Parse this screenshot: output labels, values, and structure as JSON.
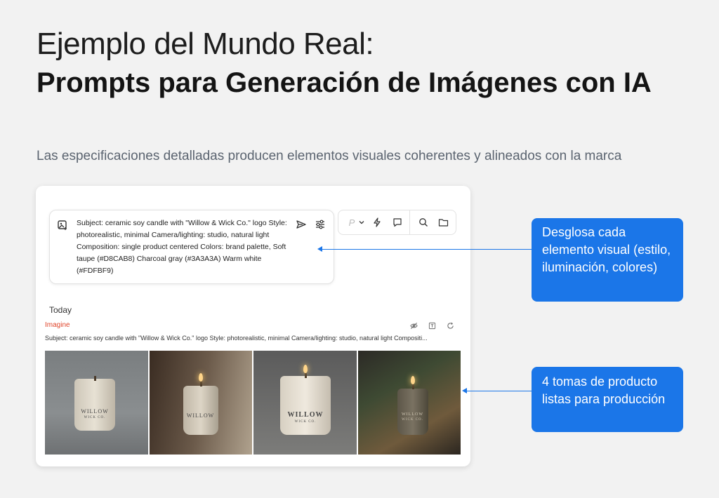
{
  "slide": {
    "title_line1": "Ejemplo del Mundo Real:",
    "title_line2": "Prompts para Generación de Imágenes con IA",
    "subtitle": "Las especificaciones detalladas producen elementos visuales coherentes y alineados con la marca"
  },
  "prompt_box": {
    "text": "Subject: ceramic soy candle with \"Willow & Wick Co.\" logo Style: photorealistic, minimal Camera/lighting: studio, natural light Composition: single product centered Colors: brand palette, Soft taupe (#D8CAB8) Charcoal gray (#3A3A3A) Warm white (#FDFBF9)"
  },
  "toolbar": {
    "model_letter": "P"
  },
  "history": {
    "section": "Today",
    "tag": "Imagine",
    "prompt_preview": "Subject: ceramic soy candle with \"Willow & Wick Co.\" logo Style: photorealistic, minimal Camera/lighting: studio, natural light Compositi..."
  },
  "images": [
    {
      "label_main": "WILLOW",
      "label_sub": "WICK CO."
    },
    {
      "label_main": "WILLOW",
      "label_sub": ""
    },
    {
      "label_main": "WILLOW",
      "label_sub": "WICK CO."
    },
    {
      "label_main": "WILLOW",
      "label_sub": "WICK CO."
    }
  ],
  "callouts": {
    "first": "Desglosa cada elemento visual (estilo, iluminación, colores)",
    "second": "4 tomas de producto listas para producción"
  },
  "colors": {
    "accent": "#1b76e8",
    "imagine_tag": "#e0452b"
  }
}
